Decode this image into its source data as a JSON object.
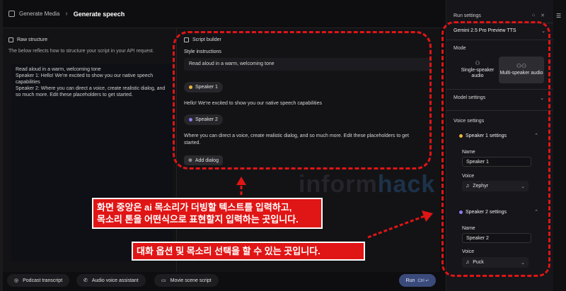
{
  "breadcrumb": {
    "parent": "Generate Media",
    "current": "Generate speech"
  },
  "raw_structure": {
    "title": "Raw structure",
    "description": "The below reflects how to structure your script in your API request.",
    "lines": [
      "Read aloud in a warm, welcoming tone",
      "Speaker 1: Hello! We're excited to show you our native speech capabilities",
      "Speaker 2: Where you can direct a voice, create realistic dialog, and so much more. Edit these placeholders to get started."
    ]
  },
  "script_builder": {
    "title": "Script builder",
    "style_label": "Style instructions",
    "style_value": "Read aloud in a warm, welcoming tone",
    "speaker1": {
      "name": "Speaker 1",
      "text": "Hello! We're excited to show you our native speech capabilities",
      "color": "#f0b43c"
    },
    "speaker2": {
      "name": "Speaker 2",
      "text": "Where you can direct a voice, create realistic dialog, and so much more. Edit these placeholders to get started.",
      "color": "#8f7cf0"
    },
    "add_dialog": "Add dialog"
  },
  "bottom": {
    "podcast": "Podcast transcript",
    "voice_assistant": "Audio voice assistant",
    "movie_scene": "Movie scene script",
    "run": "Run",
    "run_shortcut": "Ctrl ↵"
  },
  "run_settings": {
    "title": "Run settings",
    "model": "Gemini 2.5 Pro Preview TTS",
    "mode_label": "Mode",
    "mode_single": "Single-speaker audio",
    "mode_multi": "Multi-speaker audio",
    "model_settings": "Model settings",
    "voice_settings": "Voice settings",
    "speaker1_settings": "Speaker 1 settings",
    "speaker2_settings": "Speaker 2 settings",
    "name_label": "Name",
    "voice_label": "Voice",
    "speaker1_name": "Speaker 1",
    "speaker1_voice": "Zephyr",
    "speaker2_name": "Speaker 2",
    "speaker2_voice": "Puck"
  },
  "annotations": {
    "callout1_line1": "화면 중앙은 ai 목소리가 더빙할 텍스트를 입력하고,",
    "callout1_line2": "목소리 톤을 어떤식으로 표현할지 입력하는 곳입니다.",
    "callout2": "대화 옵션 및 목소리 선택을 할 수 있는 곳입니다.",
    "watermark_a": "inform",
    "watermark_b": "hack",
    "accent_color": "#e01515"
  }
}
